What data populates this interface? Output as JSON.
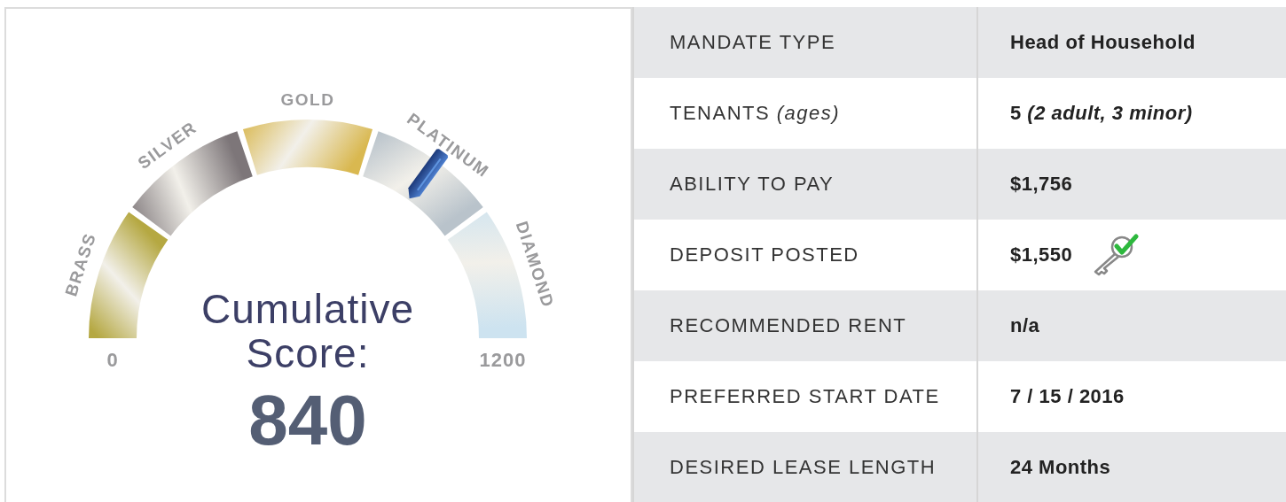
{
  "gauge": {
    "tiers": [
      {
        "label": "BRASS",
        "color": "#b5a842"
      },
      {
        "label": "SILVER",
        "color": "#7d7679"
      },
      {
        "label": "GOLD",
        "color": "#d9b850"
      },
      {
        "label": "PLATINUM",
        "color": "#b9c3cb"
      },
      {
        "label": "DIAMOND",
        "color": "#cde3f0"
      }
    ],
    "min_label": "0",
    "max_label": "1200",
    "level": 0.7
  },
  "score": {
    "caption": "Cumulative Score:",
    "value": "840"
  },
  "details": [
    {
      "label": "MANDATE TYPE",
      "value": "Head of Household",
      "verified": false
    },
    {
      "label": "TENANTS *(ages)*",
      "value": "5 *(2 adult, 3 minor)*",
      "verified": false
    },
    {
      "label": "ABILITY TO PAY",
      "value": "$1,756",
      "verified": false
    },
    {
      "label": "DEPOSIT POSTED",
      "value": "$1,550",
      "verified": true
    },
    {
      "label": "RECOMMENDED RENT",
      "value": "n/a",
      "verified": false
    },
    {
      "label": "PREFERRED START DATE",
      "value": "7 / 15 / 2016",
      "verified": false
    },
    {
      "label": "DESIRED LEASE LENGTH",
      "value": "24 Months",
      "verified": false
    }
  ]
}
